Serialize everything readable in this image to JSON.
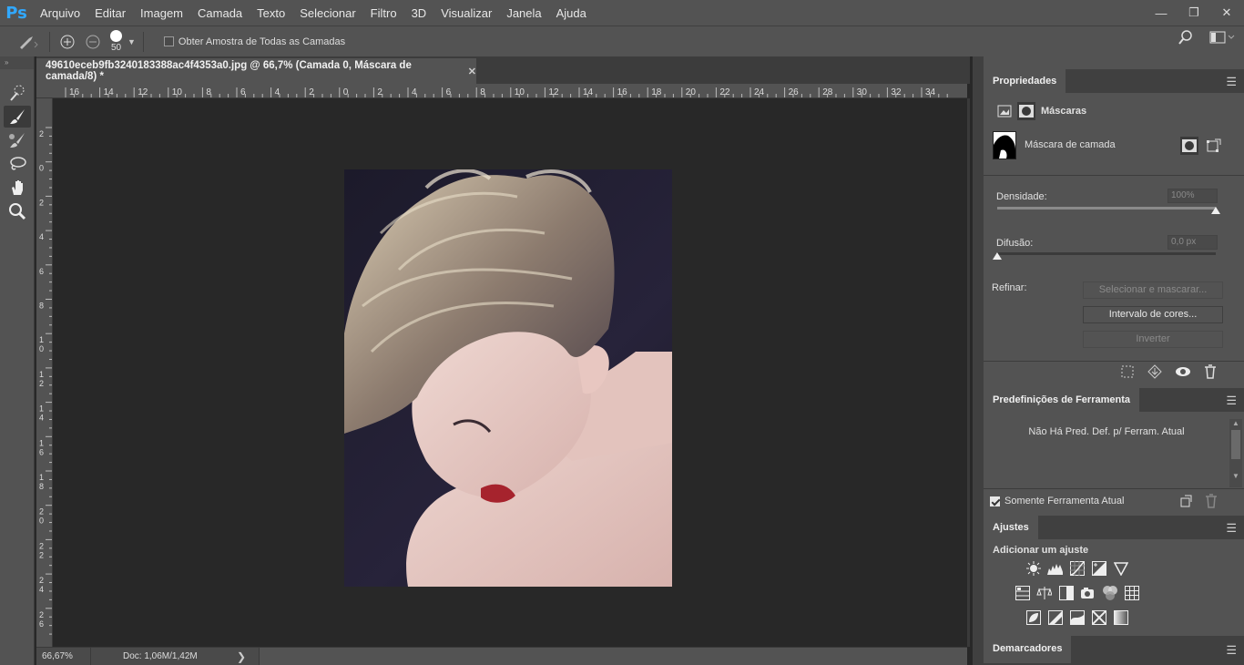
{
  "app": {
    "logo": "Ps"
  },
  "menu": [
    "Arquivo",
    "Editar",
    "Imagem",
    "Camada",
    "Texto",
    "Selecionar",
    "Filtro",
    "3D",
    "Visualizar",
    "Janela",
    "Ajuda"
  ],
  "window_controls": {
    "minimize": "—",
    "restore": "❐",
    "close": "✕"
  },
  "options": {
    "brush_size": "50",
    "sample_all_layers_label": "Obter Amostra de Todas as Camadas",
    "sample_all_layers_checked": false
  },
  "toolbar": {
    "collapse": "»",
    "tools": [
      "quick-selection",
      "brush",
      "mixer-brush",
      "lasso",
      "hand",
      "zoom"
    ],
    "active_tool": "brush"
  },
  "document": {
    "tab_title": "49610eceb9fb3240183388ac4f4353a0.jpg @ 66,7% (Camada 0, Máscara de camada/8) *",
    "close": "✕"
  },
  "ruler_top_labels": [
    "16",
    "14",
    "12",
    "10",
    "8",
    "6",
    "4",
    "2",
    "0",
    "2",
    "4",
    "6",
    "8",
    "10",
    "12",
    "14",
    "16",
    "18",
    "20",
    "22",
    "24",
    "26",
    "28",
    "30",
    "32",
    "34"
  ],
  "ruler_left_labels": [
    "2",
    "0",
    "2",
    "4",
    "6",
    "8",
    "10",
    "12",
    "14",
    "16",
    "18",
    "20",
    "22",
    "24",
    "26"
  ],
  "status": {
    "zoom": "66,67%",
    "doc_info": "Doc: 1,06M/1,42M",
    "arrow": "❯"
  },
  "properties": {
    "title": "Propriedades",
    "section": "Máscaras",
    "mask_name": "Máscara de camada",
    "density_label": "Densidade:",
    "density_value": "100%",
    "density_level": 1.0,
    "feather_label": "Difusão:",
    "feather_value": "0,0 px",
    "feather_level": 0.0,
    "refine_label": "Refinar:",
    "btn_select_mask": "Selecionar e mascarar...",
    "btn_color_range": "Intervalo de cores...",
    "btn_invert": "Inverter"
  },
  "tool_presets": {
    "title": "Predefinições de Ferramenta",
    "empty_message": "Não Há Pred. Def. p/ Ferram. Atual",
    "current_tool_only_label": "Somente Ferramenta Atual",
    "current_tool_only_checked": true
  },
  "adjustments": {
    "title": "Ajustes",
    "subtitle": "Adicionar um ajuste",
    "row1": [
      "brightness-contrast-icon",
      "levels-icon",
      "curves-icon",
      "exposure-icon",
      "vibrance-icon"
    ],
    "row2": [
      "hue-saturation-icon",
      "color-balance-icon",
      "black-white-icon",
      "photo-filter-icon",
      "channel-mixer-icon",
      "color-lookup-icon"
    ],
    "row3": [
      "invert-icon",
      "posterize-icon",
      "threshold-icon",
      "selective-color-icon",
      "gradient-map-icon"
    ]
  },
  "guides": {
    "title": "Demarcadores"
  },
  "colors": {
    "accent": "#31a8ff",
    "panel": "#535353",
    "canvas": "#282828",
    "lips": "#a6232d"
  }
}
